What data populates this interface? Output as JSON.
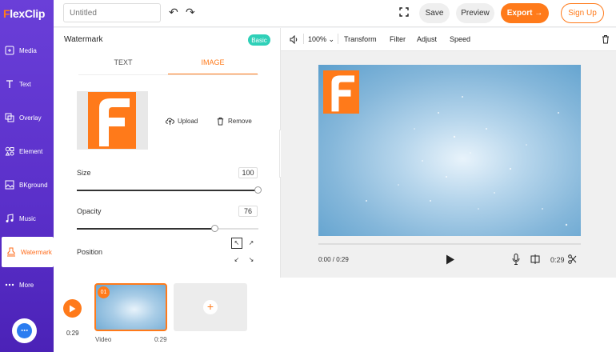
{
  "app": {
    "logo_f": "F",
    "logo_rest": "lexClip"
  },
  "sidebar": {
    "items": [
      {
        "label": "Media",
        "icon": "media-icon"
      },
      {
        "label": "Text",
        "icon": "text-icon"
      },
      {
        "label": "Overlay",
        "icon": "overlay-icon"
      },
      {
        "label": "Element",
        "icon": "element-icon"
      },
      {
        "label": "BKground",
        "icon": "background-icon"
      },
      {
        "label": "Music",
        "icon": "music-icon"
      },
      {
        "label": "Watermark",
        "icon": "watermark-icon",
        "active": true
      },
      {
        "label": "More",
        "icon": "more-icon"
      }
    ]
  },
  "topbar": {
    "title_placeholder": "Untitled",
    "save_label": "Save",
    "preview_label": "Preview",
    "export_label": "Export →",
    "signup_label": "Sign Up"
  },
  "panel": {
    "title": "Watermark",
    "badge": "Basic",
    "tabs": [
      {
        "label": "TEXT"
      },
      {
        "label": "IMAGE",
        "active": true
      }
    ],
    "upload_label": "Upload",
    "remove_label": "Remove",
    "size": {
      "label": "Size",
      "value": "100"
    },
    "opacity": {
      "label": "Opacity",
      "value": "76"
    },
    "position": {
      "label": "Position",
      "selected": "top-left"
    }
  },
  "toolbar": {
    "zoom": "100%",
    "transform": "Transform",
    "filter": "Filter",
    "adjust": "Adjust",
    "speed": "Speed"
  },
  "player": {
    "current": "0:00 / 0:29",
    "duration": "0:29"
  },
  "timeline": {
    "time": "0:29",
    "clip_number": "01",
    "clip_label": "Video",
    "clip_duration": "0:29"
  },
  "colors": {
    "brand_orange": "#ff7a1a",
    "sidebar_purple": "#5a2fc9",
    "badge_teal": "#2fd0b8"
  }
}
